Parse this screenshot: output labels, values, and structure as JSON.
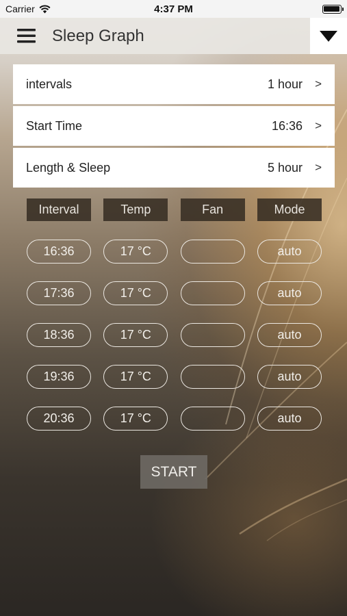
{
  "status_bar": {
    "carrier": "Carrier",
    "time": "4:37 PM"
  },
  "header": {
    "title": "Sleep Graph",
    "menu_icon": "hamburger-menu-icon",
    "dropdown_icon": "triangle-down-icon"
  },
  "settings": [
    {
      "label": "intervals",
      "value": "1 hour",
      "chevron": ">"
    },
    {
      "label": "Start Time",
      "value": "16:36",
      "chevron": ">"
    },
    {
      "label": "Length & Sleep",
      "value": "5 hour",
      "chevron": ">"
    }
  ],
  "columns": [
    "Interval",
    "Temp",
    "Fan",
    "Mode"
  ],
  "schedule": [
    {
      "interval": "16:36",
      "temp": "17 °C",
      "fan": "",
      "mode": "auto"
    },
    {
      "interval": "17:36",
      "temp": "17 °C",
      "fan": "",
      "mode": "auto"
    },
    {
      "interval": "18:36",
      "temp": "17 °C",
      "fan": "",
      "mode": "auto"
    },
    {
      "interval": "19:36",
      "temp": "17 °C",
      "fan": "",
      "mode": "auto"
    },
    {
      "interval": "20:36",
      "temp": "17 °C",
      "fan": "",
      "mode": "auto"
    }
  ],
  "start_label": "START"
}
